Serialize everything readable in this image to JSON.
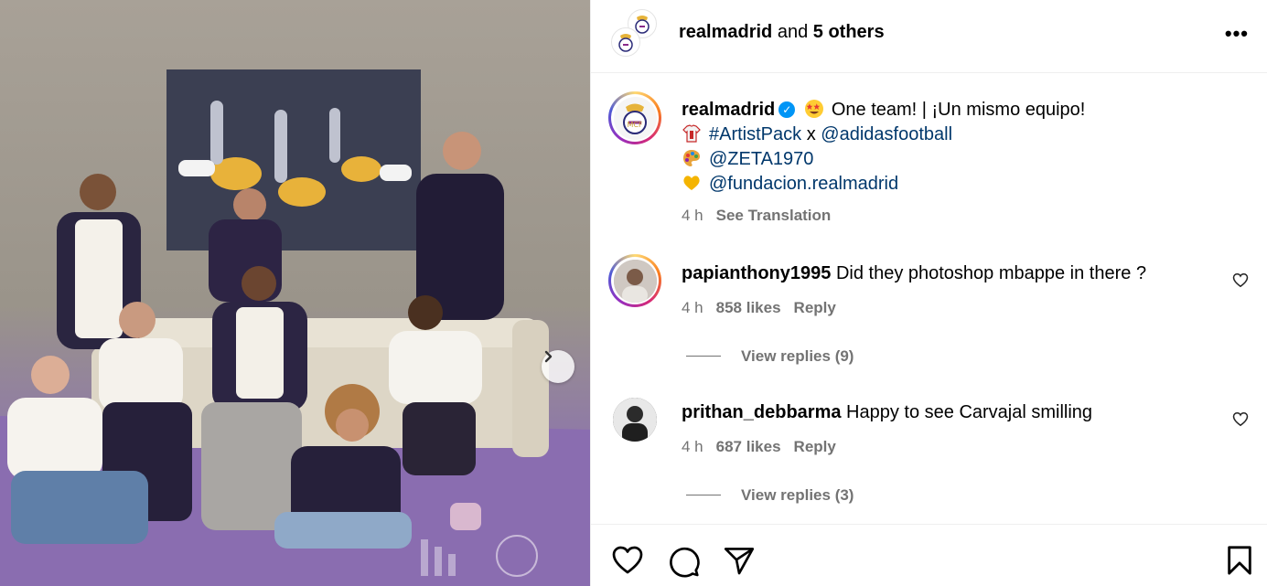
{
  "post": {
    "photo_alt": "Group photo of people wearing artist-pack shirts in front of a painting",
    "next_button_icon": "chevron-right-icon"
  },
  "header": {
    "username": "realmadrid",
    "and_text": "and",
    "others": "5 others",
    "more_icon": "more-options-icon",
    "more_glyph": "•••"
  },
  "caption": {
    "username": "realmadrid",
    "verified_glyph": "✓",
    "text": "One team! | ¡Un mismo equipo!",
    "line2_hashtag": "#ArtistPack",
    "line2_x": "x",
    "line2_mention": "@adidasfootball",
    "line3_mention": "@ZETA1970",
    "line4_mention": "@fundacion.realmadrid",
    "time": "4 h",
    "translate": "See Translation"
  },
  "comments": [
    {
      "username": "papianthony1995",
      "text": "Did they photoshop mbappe in there ?",
      "time": "4 h",
      "likes": "858 likes",
      "reply": "Reply",
      "view_replies": "View replies (9)"
    },
    {
      "username": "prithan_debbarma",
      "text": "Happy to see Carvajal smilling",
      "time": "4 h",
      "likes": "687 likes",
      "reply": "Reply",
      "view_replies": "View replies (3)"
    }
  ],
  "colors": {
    "link": "#00376b",
    "verified": "#0095f6",
    "secondary_text": "#737373",
    "divider": "#efefef"
  }
}
